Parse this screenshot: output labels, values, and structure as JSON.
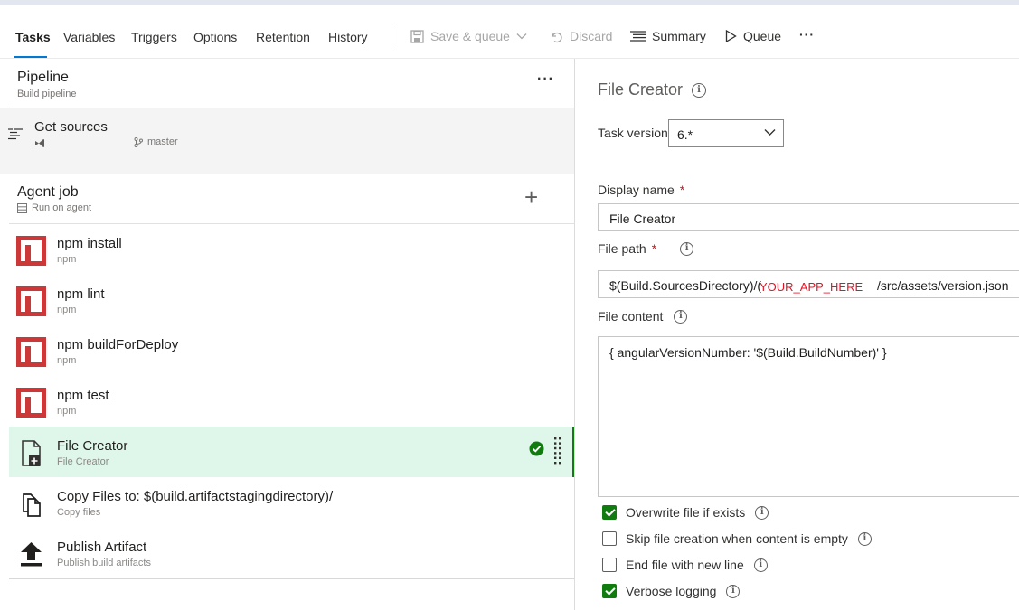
{
  "toolbar": {
    "tabs": [
      "Tasks",
      "Variables",
      "Triggers",
      "Options",
      "Retention",
      "History"
    ],
    "active_tab": "Tasks",
    "save_queue_label": "Save & queue",
    "discard_label": "Discard",
    "summary_label": "Summary",
    "queue_label": "Queue",
    "more_label": "···"
  },
  "pipeline": {
    "title": "Pipeline",
    "subtitle": "Build pipeline",
    "more": "···"
  },
  "get_sources": {
    "title": "Get sources",
    "branch": "master"
  },
  "agent_job": {
    "title": "Agent job",
    "subtitle": "Run on agent",
    "add": "+"
  },
  "tasks": [
    {
      "title": "npm install",
      "subtitle": "npm",
      "icon": "npm-icon"
    },
    {
      "title": "npm lint",
      "subtitle": "npm",
      "icon": "npm-icon"
    },
    {
      "title": "npm buildForDeploy",
      "subtitle": "npm",
      "icon": "npm-icon"
    },
    {
      "title": "npm test",
      "subtitle": "npm",
      "icon": "npm-icon"
    },
    {
      "title": "File Creator",
      "subtitle": "File Creator",
      "icon": "file-creator-icon",
      "selected": true
    },
    {
      "title": "Copy Files to: $(build.artifactstagingdirectory)/",
      "subtitle": "Copy files",
      "icon": "copy-files-icon"
    },
    {
      "title": "Publish Artifact",
      "subtitle": "Publish build artifacts",
      "icon": "publish-artifact-icon"
    }
  ],
  "details": {
    "title": "File Creator",
    "task_version_label": "Task version",
    "task_version_value": "6.*",
    "display_name_label": "Display name",
    "display_name_value": "File Creator",
    "file_path_label": "File path",
    "file_path_prefix": "$(Build.SourcesDirectory)/(",
    "file_path_highlight": "YOUR_APP_HERE",
    "file_path_suffix": "/src/assets/version.json",
    "file_content_label": "File content",
    "file_content_value": "{ angularVersionNumber: '$(Build.BuildNumber)' }",
    "required_mark": "*",
    "options": [
      {
        "label": "Overwrite file if exists",
        "checked": true
      },
      {
        "label": "Skip file creation when content is empty",
        "checked": false
      },
      {
        "label": "End file with new line",
        "checked": false
      },
      {
        "label": "Verbose logging",
        "checked": true
      }
    ]
  },
  "colors": {
    "accent": "#0078d4",
    "npm_red": "#cb3837",
    "selected_bg": "#dff6ea",
    "check_green": "#107c10",
    "highlight_red": "#e81123"
  }
}
